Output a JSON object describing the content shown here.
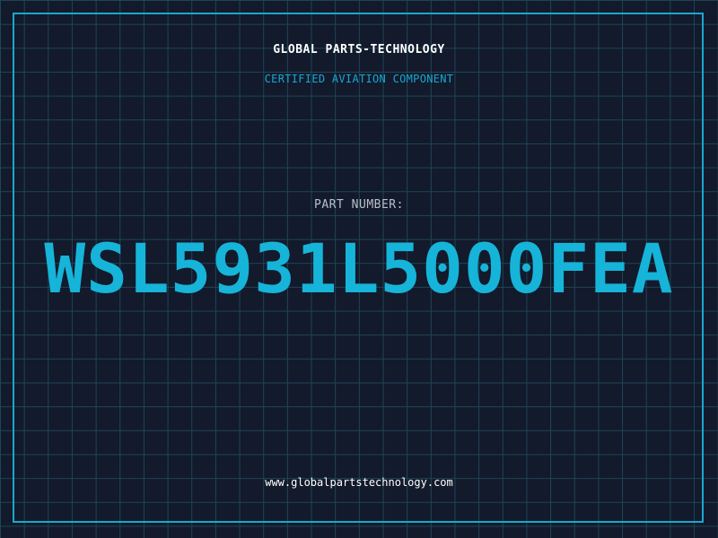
{
  "header": {
    "company": "GLOBAL PARTS-TECHNOLOGY",
    "subtitle": "CERTIFIED AVIATION COMPONENT"
  },
  "part": {
    "label": "PART NUMBER:",
    "number": "WSL5931L5000FEA"
  },
  "footer": {
    "website": "www.globalpartstechnology.com"
  },
  "colors": {
    "background": "#121a2c",
    "grid": "#1d4656",
    "accent": "#1aa7cf",
    "part_number": "#16b4d9"
  }
}
